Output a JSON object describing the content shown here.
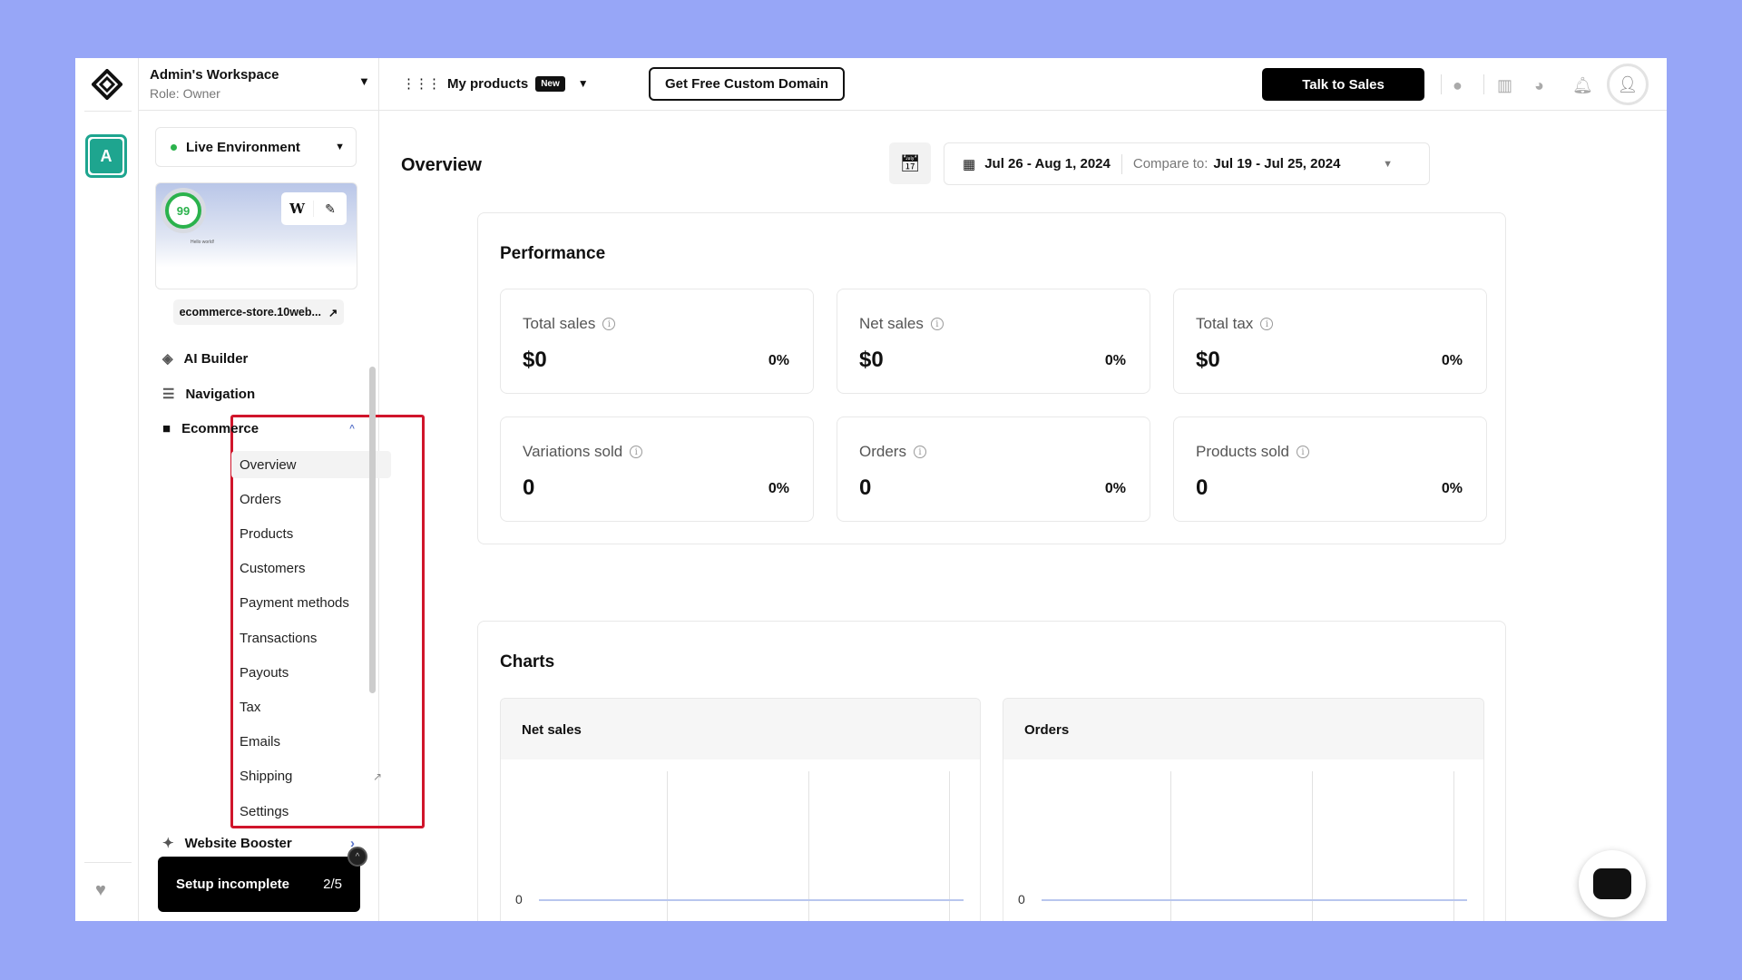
{
  "workspace": {
    "name": "Admin's Workspace",
    "role": "Role: Owner",
    "avatar_letter": "A"
  },
  "header": {
    "my_products": "My products",
    "new_badge": "New",
    "custom_domain": "Get Free Custom Domain",
    "talk_to_sales": "Talk to Sales",
    "icons": [
      "clock-icon",
      "book-icon",
      "pie-chart-icon",
      "bell-icon",
      "user-avatar-icon"
    ]
  },
  "environment": {
    "label": "Live Environment",
    "status_color": "#2bb24c"
  },
  "site": {
    "score": "99",
    "wp": "W",
    "preview_title": "Hello world!",
    "domain": "ecommerce-store.10web..."
  },
  "nav": {
    "ai_builder": "AI Builder",
    "navigation": "Navigation",
    "ecommerce": "Ecommerce",
    "website_booster": "Website Booster",
    "ecommerce_items": [
      "Overview",
      "Orders",
      "Products",
      "Customers",
      "Payment methods",
      "Transactions",
      "Payouts",
      "Tax",
      "Emails",
      "Shipping",
      "Settings"
    ]
  },
  "setup": {
    "label": "Setup incomplete",
    "progress": "2/5"
  },
  "overview": {
    "title": "Overview",
    "date_range": "Jul 26 - Aug 1, 2024",
    "compare_label": "Compare to:",
    "compare_range": "Jul 19 - Jul 25, 2024"
  },
  "performance": {
    "title": "Performance",
    "metrics": [
      {
        "label": "Total sales",
        "value": "$0",
        "change": "0%"
      },
      {
        "label": "Net sales",
        "value": "$0",
        "change": "0%"
      },
      {
        "label": "Total tax",
        "value": "$0",
        "change": "0%"
      },
      {
        "label": "Variations sold",
        "value": "0",
        "change": "0%"
      },
      {
        "label": "Orders",
        "value": "0",
        "change": "0%"
      },
      {
        "label": "Products sold",
        "value": "0",
        "change": "0%"
      }
    ]
  },
  "charts": {
    "title": "Charts",
    "panels": [
      {
        "title": "Net sales",
        "zero_label": "0"
      },
      {
        "title": "Orders",
        "zero_label": "0"
      }
    ]
  },
  "colors": {
    "accent_teal": "#1ea58f",
    "highlight_red": "#d0152b",
    "background": "#97a6f7"
  }
}
